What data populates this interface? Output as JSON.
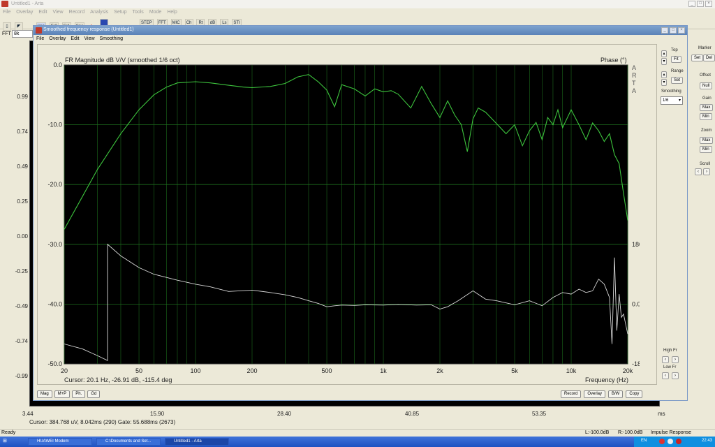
{
  "app": {
    "title": "Untitled1 - Arta",
    "menu": [
      "File",
      "Overlay",
      "Edit",
      "View",
      "Record",
      "Analysis",
      "Setup",
      "Tools",
      "Mode",
      "Help"
    ],
    "toolbar": [
      "Imp",
      "Fr2",
      "Fr1",
      "Spa",
      "STEP",
      "FFT",
      "MIC",
      "Ch",
      "Rt",
      "dB",
      "Ls",
      "STI"
    ],
    "fft_label": "FFT",
    "fft_value": "8k"
  },
  "main_plot": {
    "y_ticks": [
      "0.99",
      "0.74",
      "0.49",
      "0.25",
      "0.00",
      "-0.25",
      "-0.49",
      "-0.74",
      "-0.99"
    ],
    "x_ticks": [
      "3.44",
      "15.90",
      "28.40",
      "40.85",
      "53.35"
    ],
    "x_unit": "ms",
    "cursor": "Cursor: 384.768 uV, 8.042ms (290)  Gate: 55.688ms (2673)"
  },
  "main_right_panel": {
    "marker_label": "Marker",
    "marker_set": "Set",
    "marker_del": "Del",
    "offset_label": "Offset",
    "offset_null": "Null",
    "gain_label": "Gain",
    "gain_max": "Max",
    "gain_min": "Min",
    "zoom_label": "Zoom",
    "zoom_max": "Max",
    "zoom_min": "Min",
    "scroll_label": "Scroll"
  },
  "child": {
    "title": "Smoothed frequency response (Untitled1)",
    "menu": [
      "File",
      "Overlay",
      "Edit",
      "View",
      "Smoothing"
    ],
    "top_label": "Top",
    "fit_btn": "Fit",
    "range_label": "Range",
    "range_set": "Set",
    "smoothing_label": "Smoothing",
    "smoothing_value": "1/6",
    "high_fr_label": "High Fr",
    "low_fr_label": "Low Fr",
    "cursor": "Cursor: 20.1 Hz, -26.91 dB, -115.4 deg",
    "freq_label": "Frequency (Hz)",
    "buttons_left": [
      "Mag",
      "M+P",
      "Ph.",
      "Gd"
    ],
    "buttons_right": [
      "Record",
      "Overlay",
      "B/W",
      "Copy"
    ]
  },
  "chart_data": {
    "type": "line",
    "title": "FR Magnitude dB V/V (smoothed 1/6 oct)",
    "ylabel_right": "Phase (°)",
    "watermark": "ARTA",
    "xlabel": "Frequency (Hz)",
    "x_scale": "log",
    "xlim": [
      20,
      20000
    ],
    "ylim": [
      -50,
      0
    ],
    "y2lim": [
      -180,
      180
    ],
    "x_tick_labels": [
      "20",
      "50",
      "100",
      "200",
      "500",
      "1k",
      "2k",
      "5k",
      "10k",
      "20k"
    ],
    "x_tick_values": [
      20,
      50,
      100,
      200,
      500,
      1000,
      2000,
      5000,
      10000,
      20000
    ],
    "y_tick_labels": [
      "0.0",
      "-10.0",
      "-20.0",
      "-30.0",
      "-40.0",
      "-50.0"
    ],
    "y2_tick_labels": [
      "180.0",
      "0.0",
      "-180.0"
    ],
    "grid": true,
    "colors": {
      "magnitude": "#3dc43d",
      "phase": "#d8d8d8",
      "grid": "#1c6b1c",
      "background": "#000000"
    },
    "series": [
      {
        "axis": "magnitude",
        "x": [
          20,
          25,
          30,
          40,
          50,
          60,
          70,
          80,
          100,
          120,
          150,
          180,
          200,
          250,
          300,
          350,
          400,
          450,
          500,
          550,
          600,
          700,
          800,
          900,
          1000,
          1100,
          1200,
          1400,
          1600,
          1800,
          2000,
          2200,
          2400,
          2600,
          2800,
          3000,
          3200,
          3500,
          4000,
          4500,
          5000,
          5500,
          6000,
          6500,
          7000,
          7500,
          8000,
          8500,
          9000,
          10000,
          11000,
          12000,
          13000,
          14000,
          15000,
          16000,
          17000,
          18000,
          19000,
          20000
        ],
        "y": [
          -27.5,
          -22.0,
          -17.5,
          -11.5,
          -7.5,
          -5.0,
          -3.7,
          -3.0,
          -2.8,
          -3.0,
          -3.4,
          -3.7,
          -3.8,
          -3.6,
          -3.1,
          -2.0,
          -1.6,
          -2.8,
          -4.2,
          -7.0,
          -3.3,
          -4.0,
          -5.2,
          -4.0,
          -4.5,
          -4.3,
          -4.9,
          -7.2,
          -3.6,
          -6.5,
          -8.8,
          -6.0,
          -8.4,
          -10.0,
          -14.5,
          -9.0,
          -7.2,
          -7.9,
          -9.8,
          -11.5,
          -10.0,
          -13.5,
          -11.0,
          -9.6,
          -12.5,
          -8.8,
          -10.0,
          -7.5,
          -10.5,
          -7.5,
          -10.0,
          -12.5,
          -9.7,
          -11.0,
          -12.8,
          -11.5,
          -15.0,
          -16.5,
          -21.5,
          -26.0
        ]
      },
      {
        "axis": "phase",
        "x": [
          20,
          25,
          30,
          34,
          34,
          40,
          50,
          60,
          80,
          100,
          120,
          150,
          200,
          250,
          300,
          350,
          400,
          450,
          500,
          550,
          600,
          700,
          800,
          1000,
          1200,
          1500,
          1800,
          2000,
          2200,
          2500,
          3000,
          3500,
          4000,
          5000,
          6000,
          7000,
          8000,
          9000,
          10000,
          11000,
          12000,
          13000,
          14000,
          15000,
          16000,
          16500,
          17000,
          17500,
          18000,
          18500,
          19000,
          20000
        ],
        "y": [
          -120,
          -135,
          -155,
          -170,
          180,
          145,
          110,
          90,
          72,
          60,
          52,
          38,
          42,
          35,
          28,
          20,
          10,
          2,
          -8,
          -5,
          -3,
          -4,
          -2,
          -3,
          -1,
          -3,
          -2,
          -15,
          -8,
          10,
          40,
          15,
          10,
          -2,
          10,
          -5,
          20,
          35,
          30,
          45,
          35,
          40,
          75,
          60,
          20,
          -120,
          140,
          -80,
          30,
          -40,
          -30,
          -90
        ]
      }
    ]
  },
  "statusbar": {
    "left": "Ready",
    "l_level": "L:-100.0dB",
    "r_level": "R:-100.0dB",
    "mode": "Impulse Response"
  },
  "taskbar": {
    "tasks": [
      "HUAWEI Modem",
      "C:\\Documents and Set...",
      "Untitled1 - Arta"
    ],
    "lang": "EN",
    "clock": "22:43"
  }
}
